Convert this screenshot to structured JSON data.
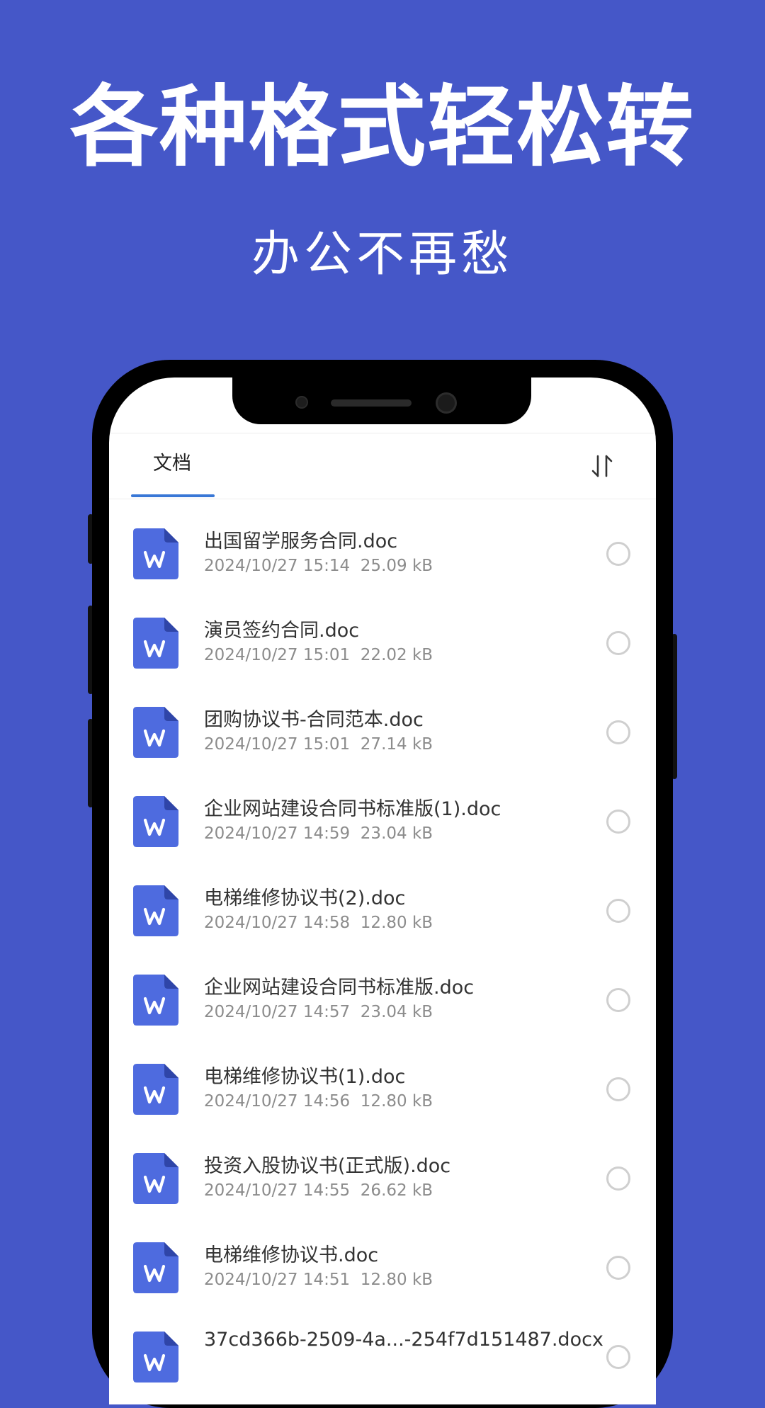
{
  "banner": {
    "title": "各种格式轻松转",
    "subtitle": "办公不再愁"
  },
  "app": {
    "tab_label": "文档",
    "sort_icon": "sort-icon",
    "file_icon": "word-doc-icon",
    "colors": {
      "background": "#4557C8",
      "tab_underline": "#3877D6",
      "doc_icon": "#4E6BDF"
    },
    "files": [
      {
        "name": "出国留学服务合同.doc",
        "date": "2024/10/27 15:14",
        "size": "25.09 kB"
      },
      {
        "name": "演员签约合同.doc",
        "date": "2024/10/27 15:01",
        "size": "22.02 kB"
      },
      {
        "name": "团购协议书-合同范本.doc",
        "date": "2024/10/27 15:01",
        "size": "27.14 kB"
      },
      {
        "name": "企业网站建设合同书标准版(1).doc",
        "date": "2024/10/27 14:59",
        "size": "23.04 kB"
      },
      {
        "name": "电梯维修协议书(2).doc",
        "date": "2024/10/27 14:58",
        "size": "12.80 kB"
      },
      {
        "name": "企业网站建设合同书标准版.doc",
        "date": "2024/10/27 14:57",
        "size": "23.04 kB"
      },
      {
        "name": "电梯维修协议书(1).doc",
        "date": "2024/10/27 14:56",
        "size": "12.80 kB"
      },
      {
        "name": "投资入股协议书(正式版).doc",
        "date": "2024/10/27 14:55",
        "size": "26.62 kB"
      },
      {
        "name": "电梯维修协议书.doc",
        "date": "2024/10/27 14:51",
        "size": "12.80 kB"
      },
      {
        "name": "37cd366b-2509-4a...-254f7d151487.docx",
        "date": "",
        "size": ""
      }
    ]
  }
}
